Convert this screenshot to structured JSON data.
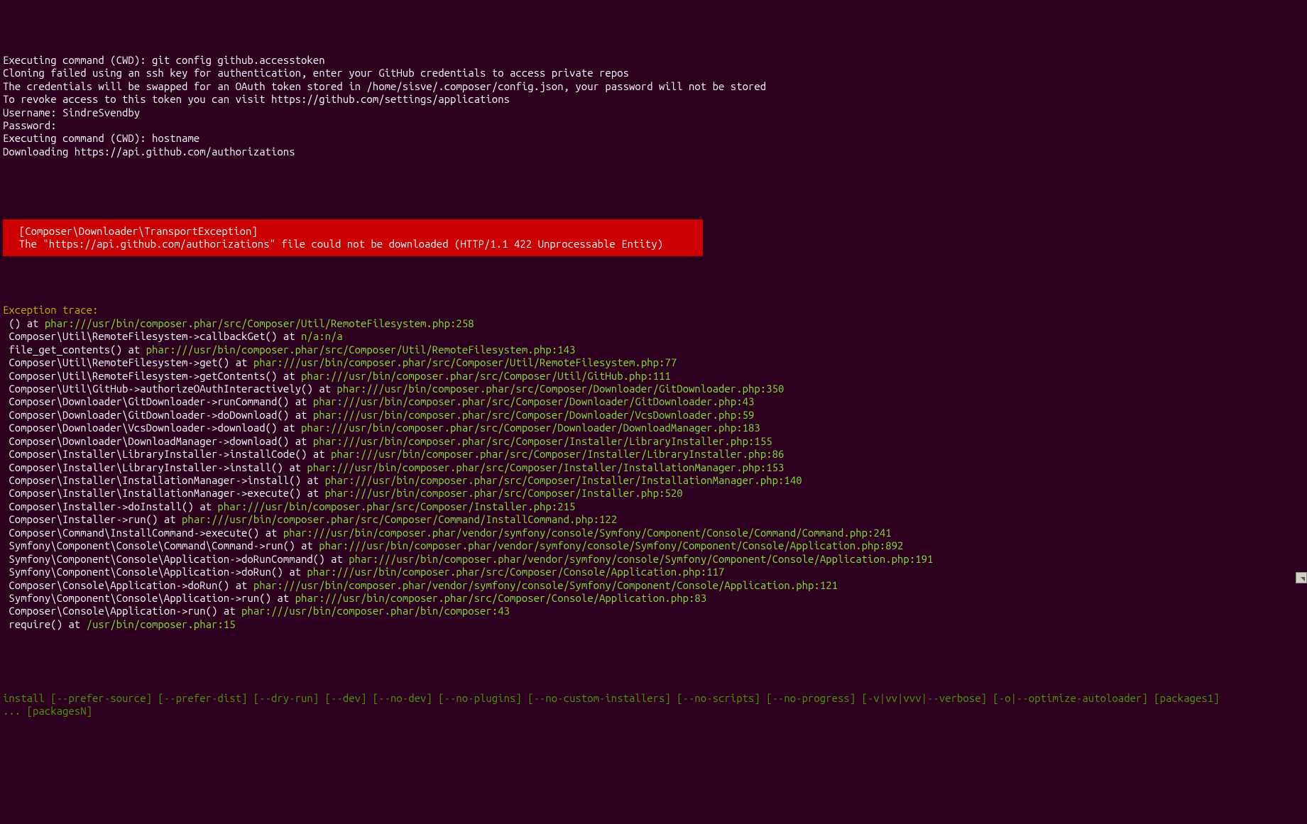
{
  "header": {
    "lines": [
      "Executing command (CWD): git config github.accesstoken",
      "Cloning failed using an ssh key for authentication, enter your GitHub credentials to access private repos",
      "The credentials will be swapped for an OAuth token stored in /home/sisve/.composer/config.json, your password will not be stored",
      "To revoke access to this token you can visit https://github.com/settings/applications",
      "Username: SindreSvendby",
      "Password:",
      "Executing command (CWD): hostname",
      "Downloading https://api.github.com/authorizations"
    ]
  },
  "error": {
    "line1": "  [Composer\\Downloader\\TransportException]                                                                          ",
    "line2": "  The \"https://api.github.com/authorizations\" file could not be downloaded (HTTP/1.1 422 Unprocessable Entity)  "
  },
  "trace_header": "Exception trace:",
  "trace": [
    {
      "pre": " () at ",
      "path": "phar:///usr/bin/composer.phar/src/Composer/Util/RemoteFilesystem.php:258"
    },
    {
      "pre": " Composer\\Util\\RemoteFilesystem->callbackGet() at ",
      "path": "n/a:n/a"
    },
    {
      "pre": " file_get_contents() at ",
      "path": "phar:///usr/bin/composer.phar/src/Composer/Util/RemoteFilesystem.php:143"
    },
    {
      "pre": " Composer\\Util\\RemoteFilesystem->get() at ",
      "path": "phar:///usr/bin/composer.phar/src/Composer/Util/RemoteFilesystem.php:77"
    },
    {
      "pre": " Composer\\Util\\RemoteFilesystem->getContents() at ",
      "path": "phar:///usr/bin/composer.phar/src/Composer/Util/GitHub.php:111"
    },
    {
      "pre": " Composer\\Util\\GitHub->authorizeOAuthInteractively() at ",
      "path": "phar:///usr/bin/composer.phar/src/Composer/Downloader/GitDownloader.php:350"
    },
    {
      "pre": " Composer\\Downloader\\GitDownloader->runCommand() at ",
      "path": "phar:///usr/bin/composer.phar/src/Composer/Downloader/GitDownloader.php:43"
    },
    {
      "pre": " Composer\\Downloader\\GitDownloader->doDownload() at ",
      "path": "phar:///usr/bin/composer.phar/src/Composer/Downloader/VcsDownloader.php:59"
    },
    {
      "pre": " Composer\\Downloader\\VcsDownloader->download() at ",
      "path": "phar:///usr/bin/composer.phar/src/Composer/Downloader/DownloadManager.php:183"
    },
    {
      "pre": " Composer\\Downloader\\DownloadManager->download() at ",
      "path": "phar:///usr/bin/composer.phar/src/Composer/Installer/LibraryInstaller.php:155"
    },
    {
      "pre": " Composer\\Installer\\LibraryInstaller->installCode() at ",
      "path": "phar:///usr/bin/composer.phar/src/Composer/Installer/LibraryInstaller.php:86"
    },
    {
      "pre": " Composer\\Installer\\LibraryInstaller->install() at ",
      "path": "phar:///usr/bin/composer.phar/src/Composer/Installer/InstallationManager.php:153"
    },
    {
      "pre": " Composer\\Installer\\InstallationManager->install() at ",
      "path": "phar:///usr/bin/composer.phar/src/Composer/Installer/InstallationManager.php:140"
    },
    {
      "pre": " Composer\\Installer\\InstallationManager->execute() at ",
      "path": "phar:///usr/bin/composer.phar/src/Composer/Installer.php:520"
    },
    {
      "pre": " Composer\\Installer->doInstall() at ",
      "path": "phar:///usr/bin/composer.phar/src/Composer/Installer.php:215"
    },
    {
      "pre": " Composer\\Installer->run() at ",
      "path": "phar:///usr/bin/composer.phar/src/Composer/Command/InstallCommand.php:122"
    },
    {
      "pre": " Composer\\Command\\InstallCommand->execute() at ",
      "path": "phar:///usr/bin/composer.phar/vendor/symfony/console/Symfony/Component/Console/Command/Command.php:241"
    },
    {
      "pre": " Symfony\\Component\\Console\\Command\\Command->run() at ",
      "path": "phar:///usr/bin/composer.phar/vendor/symfony/console/Symfony/Component/Console/Application.php:892"
    },
    {
      "pre": " Symfony\\Component\\Console\\Application->doRunCommand() at ",
      "path": "phar:///usr/bin/composer.phar/vendor/symfony/console/Symfony/Component/Console/Application.php:191"
    },
    {
      "pre": " Symfony\\Component\\Console\\Application->doRun() at ",
      "path": "phar:///usr/bin/composer.phar/src/Composer/Console/Application.php:117"
    },
    {
      "pre": " Composer\\Console\\Application->doRun() at ",
      "path": "phar:///usr/bin/composer.phar/vendor/symfony/console/Symfony/Component/Console/Application.php:121"
    },
    {
      "pre": " Symfony\\Component\\Console\\Application->run() at ",
      "path": "phar:///usr/bin/composer.phar/src/Composer/Console/Application.php:83"
    },
    {
      "pre": " Composer\\Console\\Application->run() at ",
      "path": "phar:///usr/bin/composer.phar/bin/composer:43"
    },
    {
      "pre": " require() at ",
      "path": "/usr/bin/composer.phar:15"
    }
  ],
  "usage": {
    "line1": "install [--prefer-source] [--prefer-dist] [--dry-run] [--dev] [--no-dev] [--no-plugins] [--no-custom-installers] [--no-scripts] [--no-progress] [-v|vv|vvv|--verbose] [-o|--optimize-autoloader] [packages1] ",
    "line2": "... [packagesN]"
  }
}
